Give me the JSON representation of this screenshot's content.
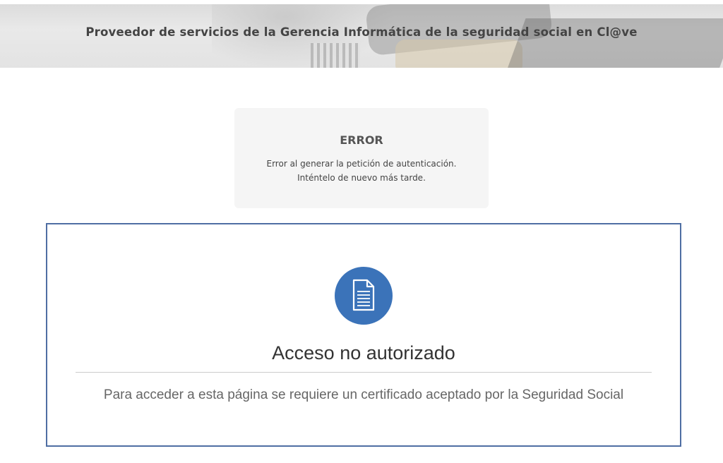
{
  "header": {
    "title": "Proveedor de servicios de la Gerencia Informática de la seguridad social en Cl@ve"
  },
  "error": {
    "title": "ERROR",
    "line1": "Error al generar la petición de autenticación.",
    "line2": "Inténtelo de nuevo más tarde."
  },
  "access": {
    "icon": "document-icon",
    "title": "Acceso no autorizado",
    "message": "Para acceder a esta página se requiere un certificado aceptado por la Seguridad Social"
  },
  "colors": {
    "accent": "#3b73b9",
    "panel_border": "#4f6ea3",
    "error_bg": "#f5f5f5"
  }
}
